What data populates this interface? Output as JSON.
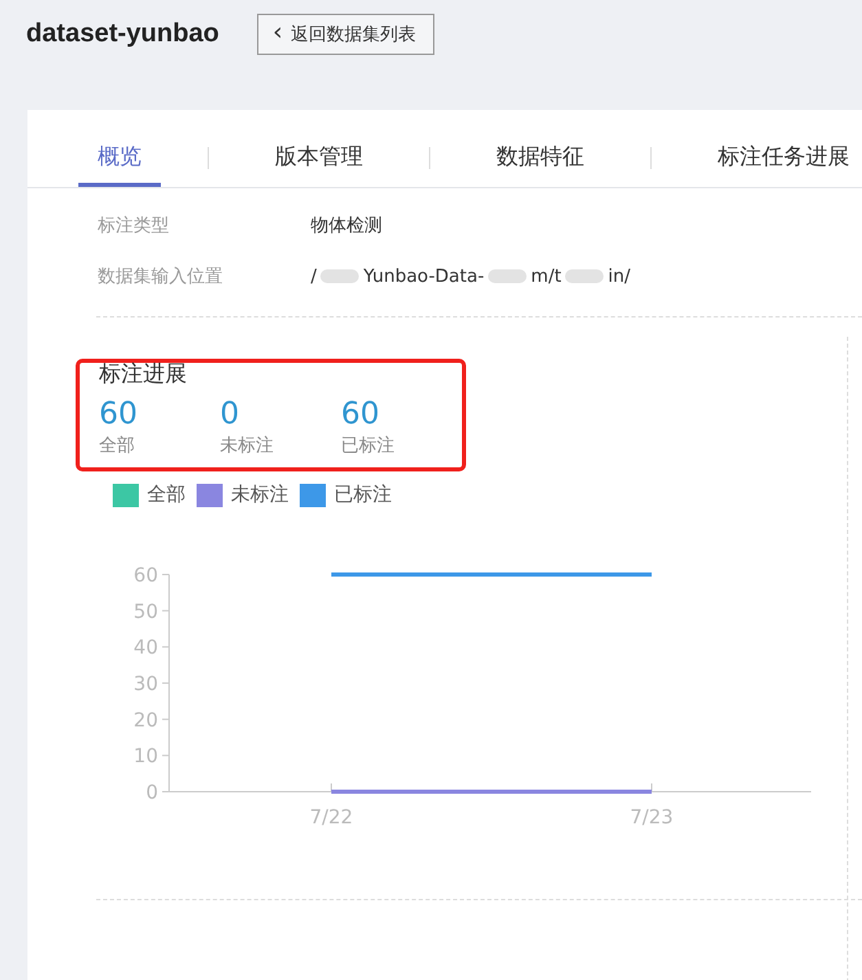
{
  "page_title": "dataset-yunbao",
  "back_button": {
    "icon": "‹",
    "label": "返回数据集列表"
  },
  "tabs": [
    {
      "label": "概览",
      "selected": true
    },
    {
      "label": "版本管理",
      "selected": false
    },
    {
      "label": "数据特征",
      "selected": false
    },
    {
      "label": "标注任务进展",
      "selected": false
    }
  ],
  "info": [
    {
      "label": "标注类型",
      "value_fragments": [
        "物体检测"
      ]
    },
    {
      "label": "数据集输入位置",
      "value_fragments": [
        "/",
        "Yunbao-Data-",
        "m/t",
        "in/"
      ]
    }
  ],
  "progress": {
    "title": "标注进展",
    "stats": [
      {
        "value": "60",
        "label": "全部"
      },
      {
        "value": "0",
        "label": "未标注"
      },
      {
        "value": "60",
        "label": "已标注"
      }
    ],
    "legend": [
      {
        "label": "全部",
        "color": "#3cc7a4"
      },
      {
        "label": "未标注",
        "color": "#8a86e0"
      },
      {
        "label": "已标注",
        "color": "#3d98e8"
      }
    ],
    "chart_data": {
      "type": "line",
      "categories": [
        "7/22",
        "7/23"
      ],
      "ylim": [
        0,
        60
      ],
      "yticks": [
        0,
        10,
        20,
        30,
        40,
        50,
        60
      ],
      "series": [
        {
          "color": "#8a86e0",
          "values": [
            0,
            0
          ]
        },
        {
          "color": "#3d98e8",
          "values": [
            60,
            60
          ]
        }
      ]
    }
  }
}
